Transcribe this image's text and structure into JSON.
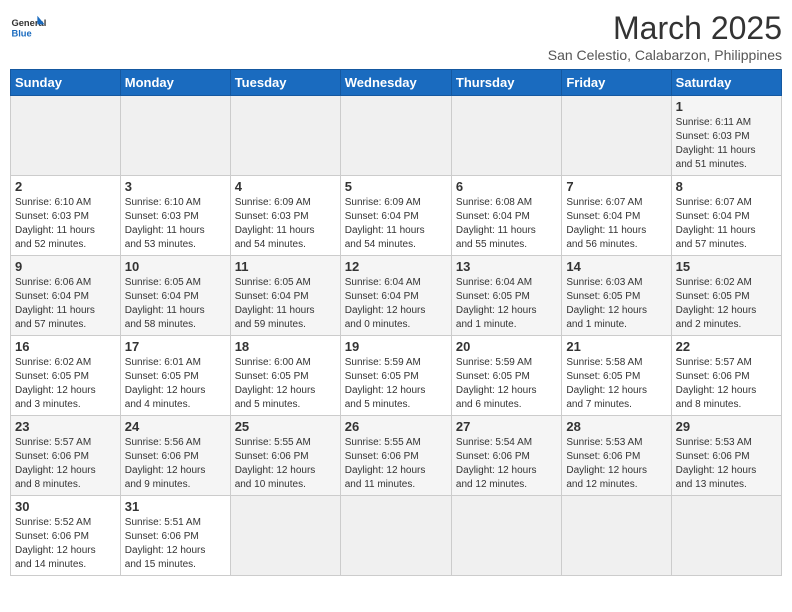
{
  "logo": {
    "text_general": "General",
    "text_blue": "Blue"
  },
  "header": {
    "month_title": "March 2025",
    "subtitle": "San Celestio, Calabarzon, Philippines"
  },
  "weekdays": [
    "Sunday",
    "Monday",
    "Tuesday",
    "Wednesday",
    "Thursday",
    "Friday",
    "Saturday"
  ],
  "weeks": [
    [
      {
        "day": "",
        "info": ""
      },
      {
        "day": "",
        "info": ""
      },
      {
        "day": "",
        "info": ""
      },
      {
        "day": "",
        "info": ""
      },
      {
        "day": "",
        "info": ""
      },
      {
        "day": "",
        "info": ""
      },
      {
        "day": "1",
        "info": "Sunrise: 6:11 AM\nSunset: 6:03 PM\nDaylight: 11 hours\nand 51 minutes."
      }
    ],
    [
      {
        "day": "2",
        "info": "Sunrise: 6:10 AM\nSunset: 6:03 PM\nDaylight: 11 hours\nand 52 minutes."
      },
      {
        "day": "3",
        "info": "Sunrise: 6:10 AM\nSunset: 6:03 PM\nDaylight: 11 hours\nand 53 minutes."
      },
      {
        "day": "4",
        "info": "Sunrise: 6:09 AM\nSunset: 6:03 PM\nDaylight: 11 hours\nand 54 minutes."
      },
      {
        "day": "5",
        "info": "Sunrise: 6:09 AM\nSunset: 6:04 PM\nDaylight: 11 hours\nand 54 minutes."
      },
      {
        "day": "6",
        "info": "Sunrise: 6:08 AM\nSunset: 6:04 PM\nDaylight: 11 hours\nand 55 minutes."
      },
      {
        "day": "7",
        "info": "Sunrise: 6:07 AM\nSunset: 6:04 PM\nDaylight: 11 hours\nand 56 minutes."
      },
      {
        "day": "8",
        "info": "Sunrise: 6:07 AM\nSunset: 6:04 PM\nDaylight: 11 hours\nand 57 minutes."
      }
    ],
    [
      {
        "day": "9",
        "info": "Sunrise: 6:06 AM\nSunset: 6:04 PM\nDaylight: 11 hours\nand 57 minutes."
      },
      {
        "day": "10",
        "info": "Sunrise: 6:05 AM\nSunset: 6:04 PM\nDaylight: 11 hours\nand 58 minutes."
      },
      {
        "day": "11",
        "info": "Sunrise: 6:05 AM\nSunset: 6:04 PM\nDaylight: 11 hours\nand 59 minutes."
      },
      {
        "day": "12",
        "info": "Sunrise: 6:04 AM\nSunset: 6:04 PM\nDaylight: 12 hours\nand 0 minutes."
      },
      {
        "day": "13",
        "info": "Sunrise: 6:04 AM\nSunset: 6:05 PM\nDaylight: 12 hours\nand 1 minute."
      },
      {
        "day": "14",
        "info": "Sunrise: 6:03 AM\nSunset: 6:05 PM\nDaylight: 12 hours\nand 1 minute."
      },
      {
        "day": "15",
        "info": "Sunrise: 6:02 AM\nSunset: 6:05 PM\nDaylight: 12 hours\nand 2 minutes."
      }
    ],
    [
      {
        "day": "16",
        "info": "Sunrise: 6:02 AM\nSunset: 6:05 PM\nDaylight: 12 hours\nand 3 minutes."
      },
      {
        "day": "17",
        "info": "Sunrise: 6:01 AM\nSunset: 6:05 PM\nDaylight: 12 hours\nand 4 minutes."
      },
      {
        "day": "18",
        "info": "Sunrise: 6:00 AM\nSunset: 6:05 PM\nDaylight: 12 hours\nand 5 minutes."
      },
      {
        "day": "19",
        "info": "Sunrise: 5:59 AM\nSunset: 6:05 PM\nDaylight: 12 hours\nand 5 minutes."
      },
      {
        "day": "20",
        "info": "Sunrise: 5:59 AM\nSunset: 6:05 PM\nDaylight: 12 hours\nand 6 minutes."
      },
      {
        "day": "21",
        "info": "Sunrise: 5:58 AM\nSunset: 6:05 PM\nDaylight: 12 hours\nand 7 minutes."
      },
      {
        "day": "22",
        "info": "Sunrise: 5:57 AM\nSunset: 6:06 PM\nDaylight: 12 hours\nand 8 minutes."
      }
    ],
    [
      {
        "day": "23",
        "info": "Sunrise: 5:57 AM\nSunset: 6:06 PM\nDaylight: 12 hours\nand 8 minutes."
      },
      {
        "day": "24",
        "info": "Sunrise: 5:56 AM\nSunset: 6:06 PM\nDaylight: 12 hours\nand 9 minutes."
      },
      {
        "day": "25",
        "info": "Sunrise: 5:55 AM\nSunset: 6:06 PM\nDaylight: 12 hours\nand 10 minutes."
      },
      {
        "day": "26",
        "info": "Sunrise: 5:55 AM\nSunset: 6:06 PM\nDaylight: 12 hours\nand 11 minutes."
      },
      {
        "day": "27",
        "info": "Sunrise: 5:54 AM\nSunset: 6:06 PM\nDaylight: 12 hours\nand 12 minutes."
      },
      {
        "day": "28",
        "info": "Sunrise: 5:53 AM\nSunset: 6:06 PM\nDaylight: 12 hours\nand 12 minutes."
      },
      {
        "day": "29",
        "info": "Sunrise: 5:53 AM\nSunset: 6:06 PM\nDaylight: 12 hours\nand 13 minutes."
      }
    ],
    [
      {
        "day": "30",
        "info": "Sunrise: 5:52 AM\nSunset: 6:06 PM\nDaylight: 12 hours\nand 14 minutes."
      },
      {
        "day": "31",
        "info": "Sunrise: 5:51 AM\nSunset: 6:06 PM\nDaylight: 12 hours\nand 15 minutes."
      },
      {
        "day": "",
        "info": ""
      },
      {
        "day": "",
        "info": ""
      },
      {
        "day": "",
        "info": ""
      },
      {
        "day": "",
        "info": ""
      },
      {
        "day": "",
        "info": ""
      }
    ]
  ]
}
